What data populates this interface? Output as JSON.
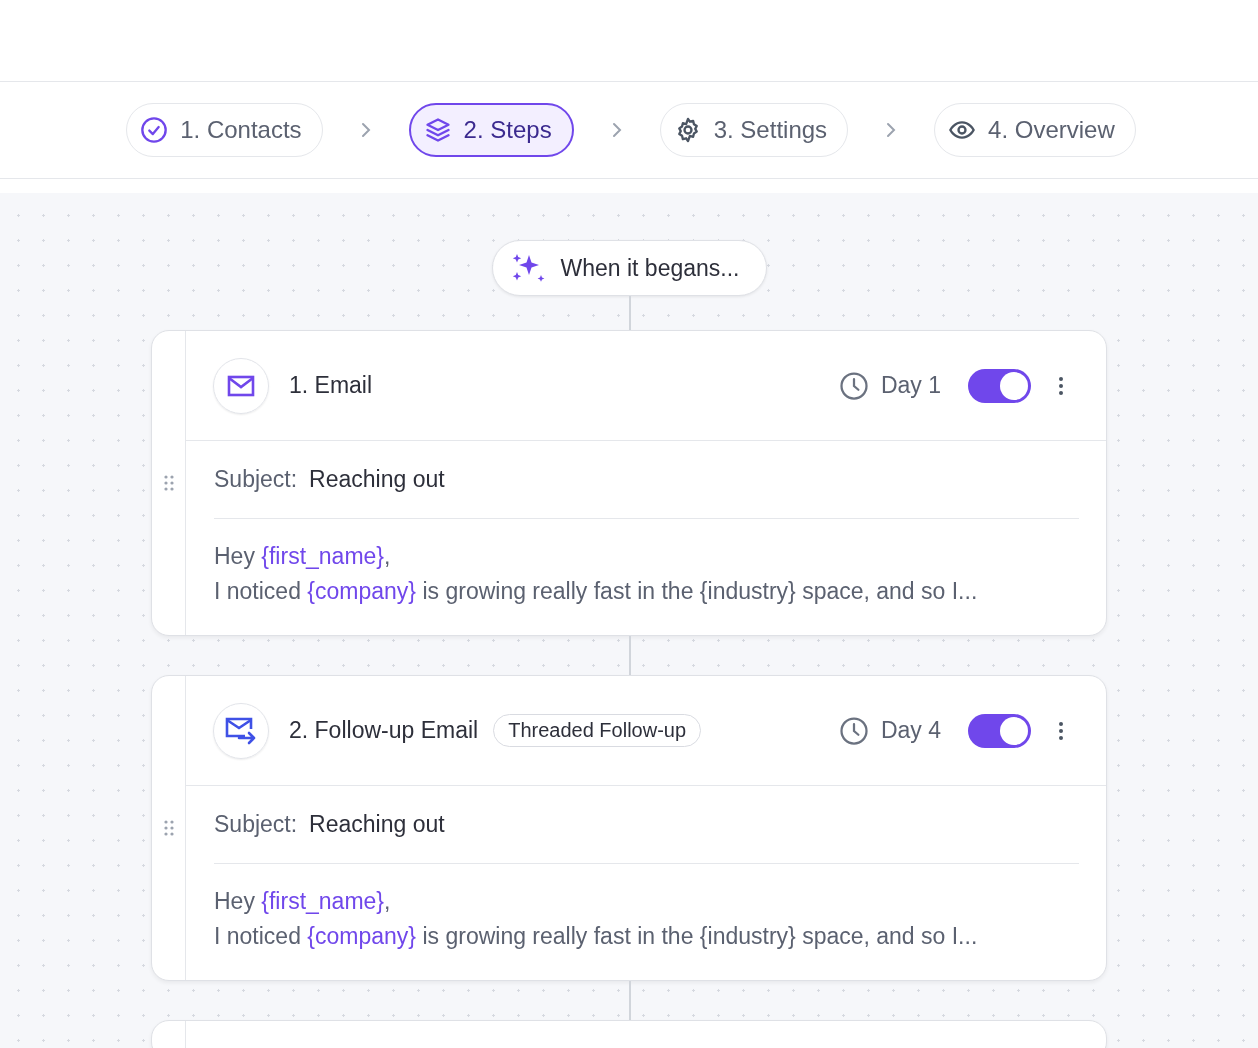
{
  "wizard": [
    {
      "label": "1. Contacts",
      "kind": "done",
      "selected": false
    },
    {
      "label": "2. Steps",
      "kind": "steps",
      "selected": true
    },
    {
      "label": "3. Settings",
      "kind": "settings",
      "selected": false
    },
    {
      "label": "4. Overview",
      "kind": "overview",
      "selected": false
    }
  ],
  "trigger": {
    "label": "When it begans..."
  },
  "steps": [
    {
      "kind": "email",
      "title": "1. Email",
      "day": "Day 1",
      "on": true,
      "subject_label": "Subject:",
      "subject": "Reaching out",
      "body": [
        [
          {
            "text": "Hey "
          },
          {
            "text": "{first_name}",
            "kind": "variable"
          },
          {
            "text": ","
          }
        ],
        [
          {
            "text": "I noticed "
          },
          {
            "text": "{company}",
            "kind": "variable"
          },
          {
            "text": " is growing really fast in the {industry} space, and so I..."
          }
        ]
      ]
    },
    {
      "kind": "followup",
      "title": "2. Follow-up Email",
      "tag": "Threaded Follow-up",
      "day": "Day 4",
      "on": true,
      "subject_label": "Subject:",
      "subject": "Reaching out",
      "body": [
        [
          {
            "text": "Hey "
          },
          {
            "text": "{first_name}",
            "kind": "variable"
          },
          {
            "text": ","
          }
        ],
        [
          {
            "text": "I noticed "
          },
          {
            "text": "{company}",
            "kind": "variable"
          },
          {
            "text": " is growing really fast in the {industry} space, and so I..."
          }
        ]
      ]
    }
  ],
  "more_steps_below": true
}
